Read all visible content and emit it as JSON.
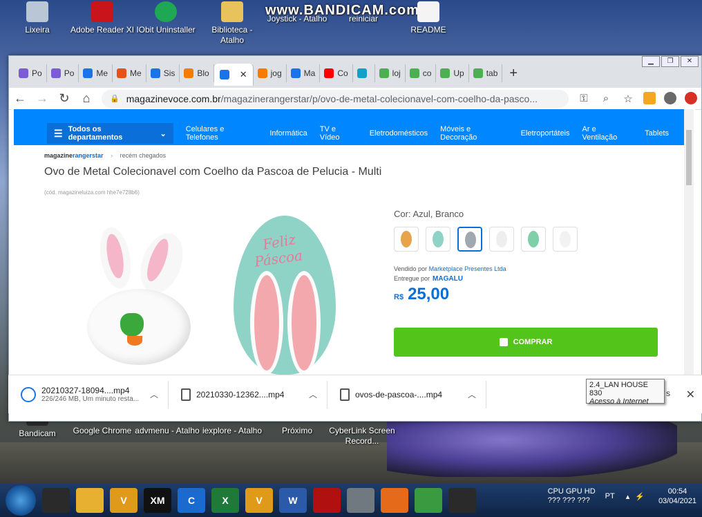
{
  "watermark": "www.BANDICAM.com",
  "desktop_icons_top": [
    {
      "label": "Lixeira"
    },
    {
      "label": "Adobe Reader XI"
    },
    {
      "label": "IObit Uninstaller"
    },
    {
      "label": "Biblioteca - Atalho"
    },
    {
      "label": "Joystick - Atalho"
    },
    {
      "label": "reiniciar"
    },
    {
      "label": "README"
    }
  ],
  "desktop_icons_bottom": [
    {
      "label": "Bandicam"
    },
    {
      "label": "Google Chrome"
    },
    {
      "label": "advmenu - Atalho"
    },
    {
      "label": "iexplore - Atalho"
    },
    {
      "label": "Próximo"
    },
    {
      "label": "CyberLink Screen Record..."
    }
  ],
  "browser": {
    "tabs": [
      {
        "label": "Po",
        "color": "#7b5cd6"
      },
      {
        "label": "Po",
        "color": "#7b5cd6"
      },
      {
        "label": "Me",
        "color": "#1a73e8"
      },
      {
        "label": "Me",
        "color": "#e8501a"
      },
      {
        "label": "Sis",
        "color": "#1a73e8"
      },
      {
        "label": "Blo",
        "color": "#f57c00"
      },
      {
        "label": "",
        "color": "#1a73e8",
        "active": true
      },
      {
        "label": "jog",
        "color": "#f57c00"
      },
      {
        "label": "Ma",
        "color": "#1a73e8"
      },
      {
        "label": "Co",
        "color": "#ff0000"
      },
      {
        "label": "",
        "color": "#12a0c8"
      },
      {
        "label": "loj",
        "color": "#4caf50"
      },
      {
        "label": "co",
        "color": "#4caf50"
      },
      {
        "label": "Up",
        "color": "#4caf50"
      },
      {
        "label": "tab",
        "color": "#4caf50"
      }
    ],
    "close_tab": "✕",
    "new_tab": "+",
    "url_domain": "magazinevoce.com.br",
    "url_path": "/magazinerangerstar/p/ovo-de-metal-colecionavel-com-coelho-da-pasco..."
  },
  "page": {
    "categories": {
      "all": "Todos os departamentos",
      "items": [
        "Celulares e Telefones",
        "Informática",
        "TV e Vídeo",
        "Eletrodomésticos",
        "Móveis e Decoração",
        "Eletroportáteis",
        "Ar e Ventilação",
        "Tablets"
      ]
    },
    "breadcrumb": {
      "store_a": "magazine",
      "store_b": "rangerstar",
      "sep": "›",
      "section": "recém chegados"
    },
    "title": "Ovo de Metal Colecionavel com Coelho da Pascoa de Pelucia - Multi",
    "code": "(cód. magazineluiza.com hhe7e728b6)",
    "egg_text_1": "Feliz",
    "egg_text_2": "Páscoa",
    "color_label": "Cor: Azul, Branco",
    "swatches": [
      {
        "color": "#e8a44a",
        "selected": false
      },
      {
        "color": "#8fd3c7",
        "selected": false
      },
      {
        "color": "#a0a8b0",
        "selected": true
      },
      {
        "color": "#eeeeee",
        "selected": false
      },
      {
        "color": "#7fd0a8",
        "selected": false
      },
      {
        "color": "#f2f2f2",
        "selected": false
      }
    ],
    "sold_by_label": "Vendido por",
    "sold_by": "Marketplace Presentes Ltda",
    "delivered_by_label": "Entregue por",
    "delivered_by": "MAGALU",
    "currency": "R$",
    "price": "25,00",
    "buy_button": "COMPRAR"
  },
  "downloads": [
    {
      "name": "20210327-18094....mp4",
      "status": "226/246 MB, Um minuto resta..."
    },
    {
      "name": "20210330-12362....mp4",
      "status": ""
    },
    {
      "name": "ovos-de-pascoa-....mp4",
      "status": ""
    }
  ],
  "tooltip": {
    "line1": "2.4_LAN HOUSE 830",
    "line2": "Acesso à Internet",
    "hidden_tail": "s"
  },
  "taskbar": {
    "apps": [
      {
        "name": "app-ccleaner",
        "label": "",
        "color": "#2a2a2a"
      },
      {
        "name": "app-explorer",
        "label": "",
        "color": "#e8b030"
      },
      {
        "name": "app-vlc",
        "label": "V",
        "color": "#e09a1a"
      },
      {
        "name": "app-xm",
        "label": "XM",
        "color": "#111111"
      },
      {
        "name": "app-cyberlink",
        "label": "C",
        "color": "#1a6ad0"
      },
      {
        "name": "app-excel",
        "label": "X",
        "color": "#1f7a3a"
      },
      {
        "name": "app-vlc-2",
        "label": "V",
        "color": "#e09a1a"
      },
      {
        "name": "app-word",
        "label": "W",
        "color": "#2a5aa8"
      },
      {
        "name": "app-red",
        "label": "",
        "color": "#b01010"
      },
      {
        "name": "app-screenshot",
        "label": "",
        "color": "#707880"
      },
      {
        "name": "app-firefox",
        "label": "",
        "color": "#e56a1a"
      },
      {
        "name": "app-chrome",
        "label": "",
        "color": "#3a9a40"
      },
      {
        "name": "app-bandicam",
        "label": "",
        "color": "#2a2a2a"
      }
    ],
    "cpu_label": "CPU GPU HD",
    "cpu_values": "???  ???  ???",
    "lang": "PT",
    "time": "00:54",
    "date": "03/04/2021"
  }
}
